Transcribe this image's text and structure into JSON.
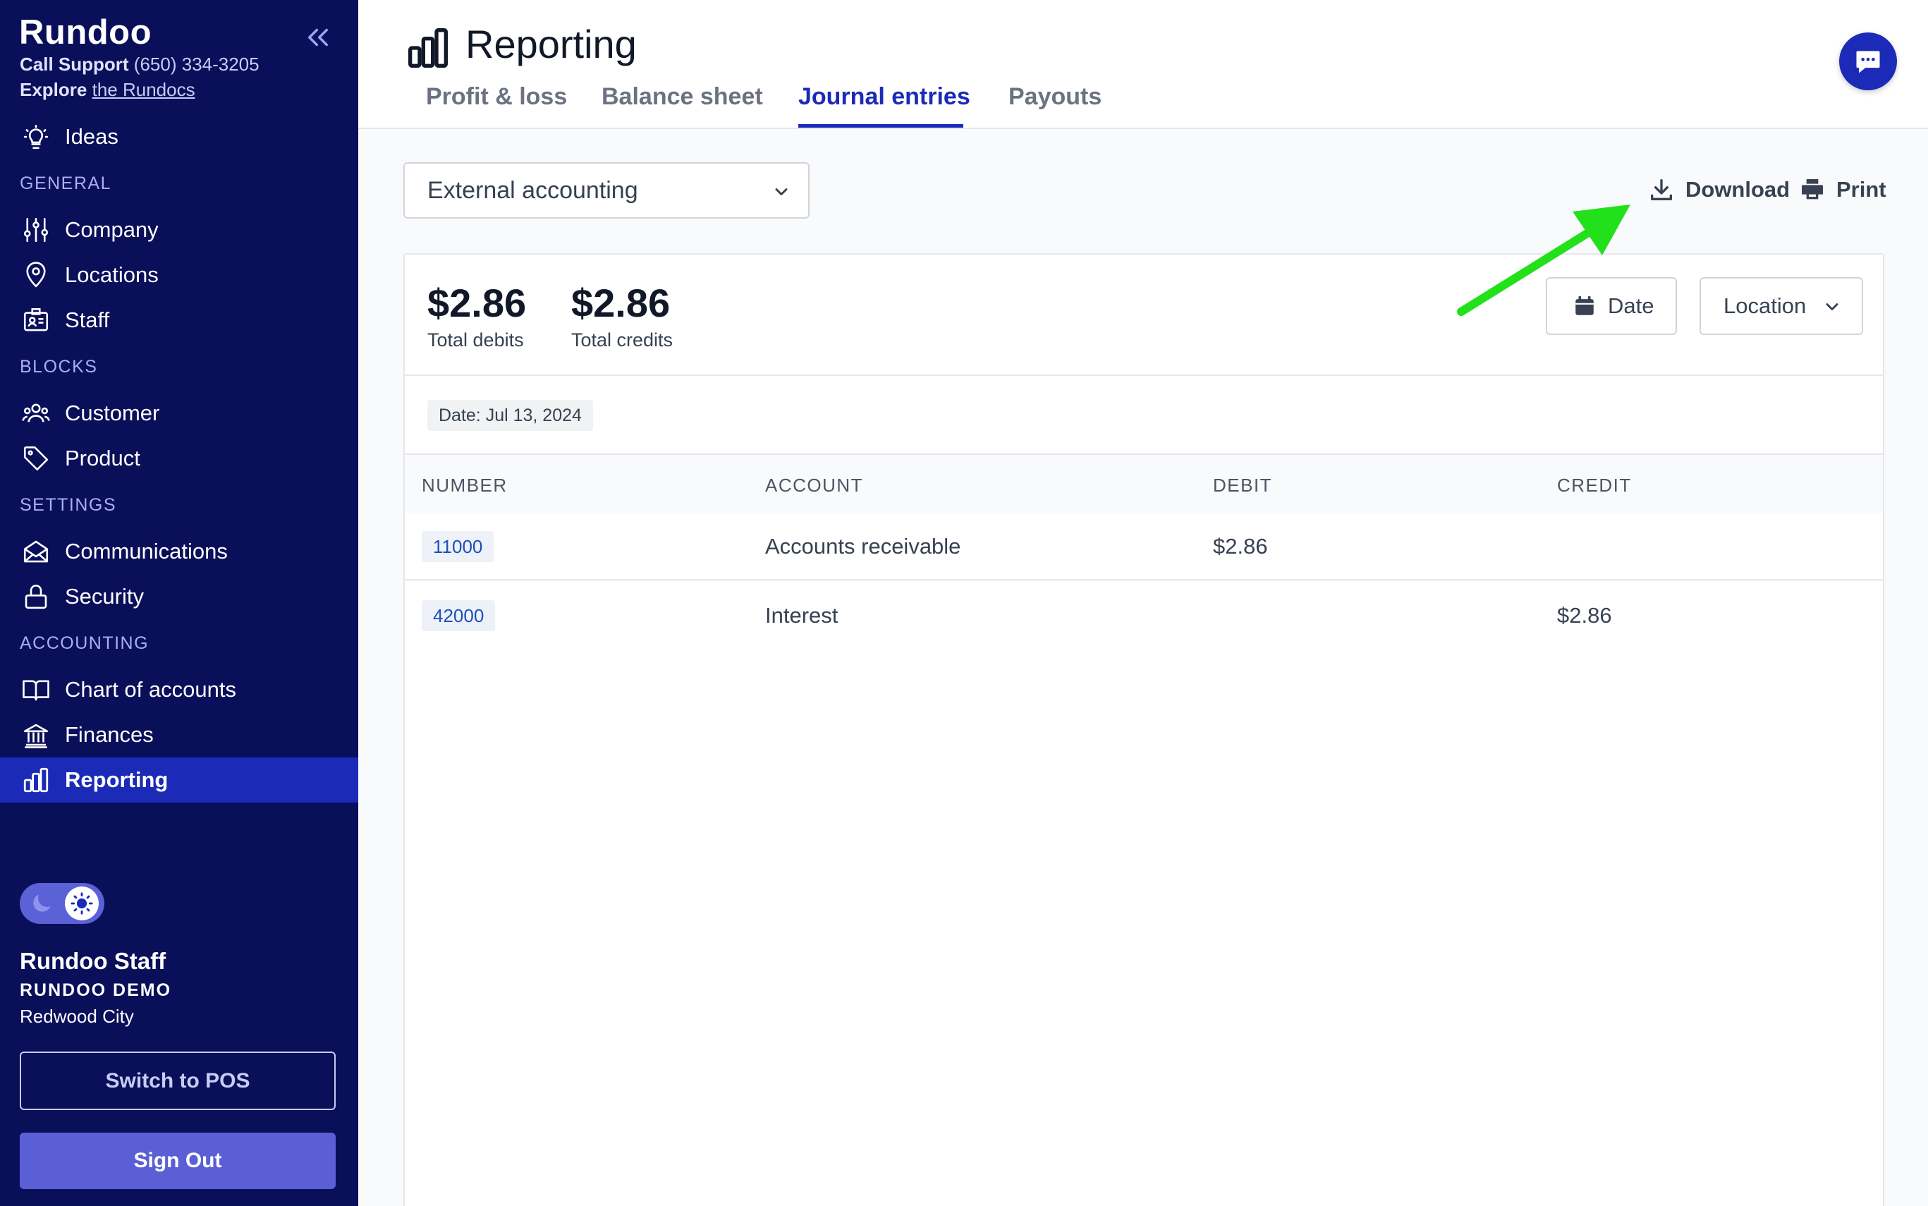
{
  "sidebar": {
    "brand": "Rundoo",
    "support_label": "Call Support",
    "support_phone": "(650) 334-3205",
    "explore_label": "Explore",
    "explore_link": "the Rundocs",
    "items": {
      "ideas": "Ideas",
      "company": "Company",
      "locations": "Locations",
      "staff": "Staff",
      "customer": "Customer",
      "product": "Product",
      "communications": "Communications",
      "security": "Security",
      "chart_of_accounts": "Chart of accounts",
      "finances": "Finances",
      "reporting": "Reporting"
    },
    "sections": {
      "general": "GENERAL",
      "blocks": "BLOCKS",
      "settings": "SETTINGS",
      "accounting": "ACCOUNTING"
    },
    "user": {
      "name": "Rundoo Staff",
      "org": "RUNDOO DEMO",
      "city": "Redwood City"
    },
    "switch_pos": "Switch to POS",
    "sign_out": "Sign Out"
  },
  "header": {
    "title": "Reporting",
    "tabs": [
      "Profit & loss",
      "Balance sheet",
      "Journal entries",
      "Payouts"
    ],
    "active_tab": "Journal entries"
  },
  "toolbar": {
    "select_value": "External accounting",
    "download": "Download",
    "print": "Print"
  },
  "summary": {
    "total_debits_value": "$2.86",
    "total_debits_label": "Total debits",
    "total_credits_value": "$2.86",
    "total_credits_label": "Total credits",
    "date_button": "Date",
    "location_button": "Location"
  },
  "date_chip": "Date: Jul 13, 2024",
  "table": {
    "headers": [
      "NUMBER",
      "ACCOUNT",
      "DEBIT",
      "CREDIT"
    ],
    "rows": [
      {
        "number": "11000",
        "account": "Accounts receivable",
        "debit": "$2.86",
        "credit": ""
      },
      {
        "number": "42000",
        "account": "Interest",
        "debit": "",
        "credit": "$2.86"
      }
    ]
  },
  "colors": {
    "sidebar_bg": "#0a0f59",
    "accent": "#1b2bb8",
    "sign_out": "#5b5fd6",
    "annotation_arrow": "#22e01a"
  }
}
